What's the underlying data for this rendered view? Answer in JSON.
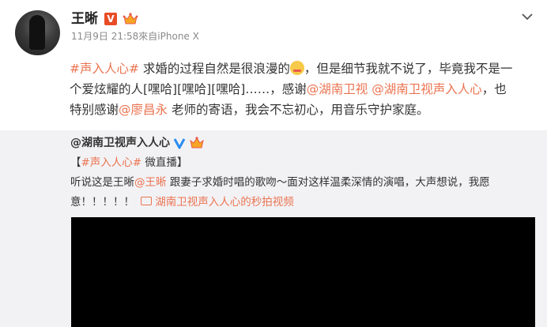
{
  "post": {
    "author": "王晰",
    "verified_badge": "V",
    "meta": "11月9日 21:58來自iPhone X",
    "line1": {
      "tag": "#声入人心#",
      "text1": " 求婚的过程自然是很浪漫的",
      "text2": "，但是细节我就不说了，毕竟我不是一"
    },
    "line2": {
      "text1": "个爱炫耀的人[嘿哈][嘿哈][嘿哈]……，感谢",
      "mention1": "@湖南卫视",
      "space": " ",
      "mention2": "@湖南卫视声入人心",
      "text2": "，也"
    },
    "line3": {
      "text1": "特别感谢",
      "mention": "@廖昌永",
      "text2": " 老师的寄语，我会不忘初心，用音乐守护家庭。"
    }
  },
  "repost": {
    "author": "@湖南卫视声入人心",
    "tag_open": "【",
    "tag": "#声入人心#",
    "tag_rest": " 微直播】",
    "line1": {
      "text1": "听说这是王晰",
      "mention": "@王晰",
      "text2": " 跟妻子求婚时唱的歌吻～面对这样温柔深情的演唱，大声想说，我愿"
    },
    "line2": {
      "text1": "意！！！！！ ",
      "video_link": "湖南卫视声入人心的秒拍视频"
    },
    "video": {
      "state": "black"
    }
  },
  "colors": {
    "accent": "#eb7350",
    "repost_bg": "#f2f2f5",
    "vip_red": "#e84c26",
    "verified_blue": "#2b8cf0"
  },
  "icons": [
    "avatar",
    "verified-badge-icon",
    "vip-crown-icon",
    "chevron-down-icon",
    "smirk-emoji-icon",
    "video-icon"
  ]
}
